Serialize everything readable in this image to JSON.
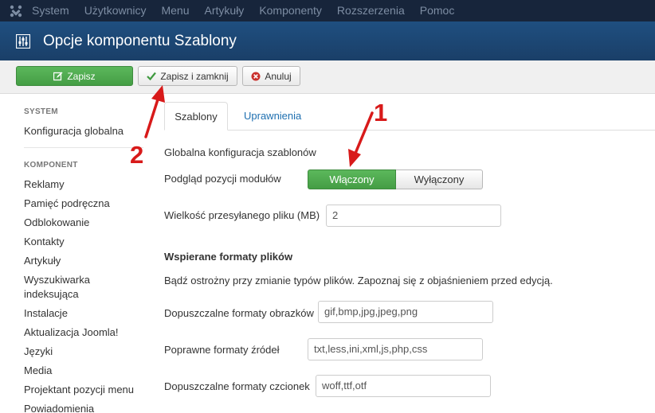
{
  "topnav": {
    "logo_icon": "joomla-logo-icon",
    "items": [
      "System",
      "Użytkownicy",
      "Menu",
      "Artykuły",
      "Komponenty",
      "Rozszerzenia",
      "Pomoc"
    ]
  },
  "titlebar": {
    "icon": "equalizer-icon",
    "title": "Opcje komponentu Szablony"
  },
  "toolbar": {
    "save_label": "Zapisz",
    "save_close_label": "Zapisz i zamknij",
    "cancel_label": "Anuluj"
  },
  "sidebar": {
    "system_header": "SYSTEM",
    "system_items": [
      "Konfiguracja globalna"
    ],
    "component_header": "KOMPONENT",
    "component_items": [
      "Reklamy",
      "Pamięć podręczna",
      "Odblokowanie",
      "Kontakty",
      "Artykuły",
      "Wyszukiwarka",
      "indeksująca",
      "Instalacje",
      "Aktualizacja Joomla!",
      "Języki",
      "Media",
      "Projektant pozycji menu",
      "Powiadomienia"
    ]
  },
  "tabs": {
    "active": "Szablony",
    "other": "Uprawnienia"
  },
  "form": {
    "global_config_label": "Globalna konfiguracja szablonów",
    "preview_label": "Podgląd pozycji modułów",
    "toggle_on": "Włączony",
    "toggle_off": "Wyłączony",
    "upload_size_label": "Wielkość przesyłanego pliku (MB)",
    "upload_size_value": "2",
    "formats_title": "Wspierane formaty plików",
    "formats_warning": "Bądź ostrożny przy zmianie typów plików. Zapoznaj się z objaśnieniem przed edycją.",
    "image_formats_label": "Dopuszczalne formaty obrazków",
    "image_formats_value": "gif,bmp,jpg,jpeg,png",
    "source_formats_label": "Poprawne formaty źródeł",
    "source_formats_value": "txt,less,ini,xml,js,php,css",
    "font_formats_label": "Dopuszczalne formaty czcionek",
    "font_formats_value": "woff,ttf,otf"
  },
  "annotations": {
    "marker_1": "1",
    "marker_2": "2",
    "color": "#d81a1a"
  }
}
